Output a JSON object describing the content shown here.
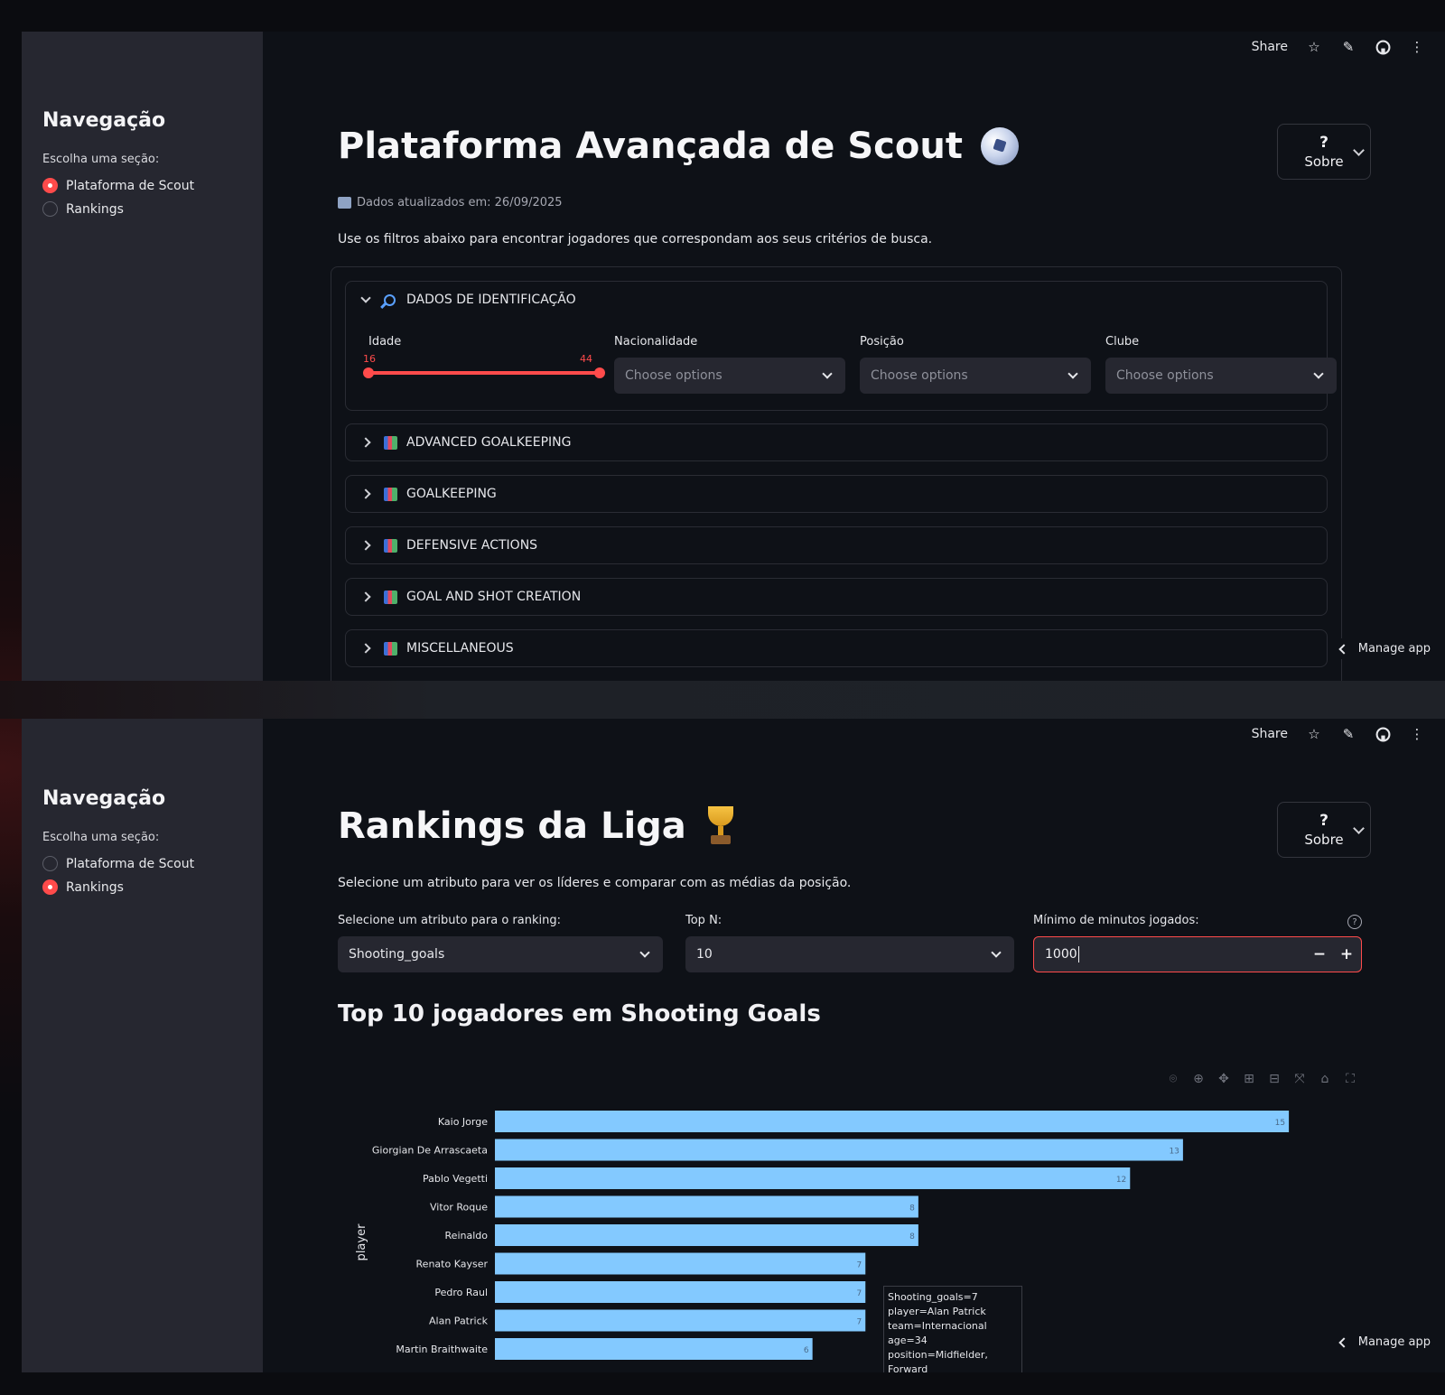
{
  "toolbar": {
    "share_label": "Share",
    "icons": [
      "star-icon",
      "pencil-icon",
      "github-icon",
      "more-vert-icon"
    ]
  },
  "sidebar": {
    "title": "Navegação",
    "label": "Escolha uma seção:",
    "options": [
      "Plataforma de Scout",
      "Rankings"
    ]
  },
  "sobre": {
    "q": "?",
    "label": "Sobre"
  },
  "manage_app": "Manage app",
  "page1": {
    "selected_option": "Plataforma de Scout",
    "title": "Plataforma Avançada de Scout",
    "updated": "Dados atualizados em: 26/09/2025",
    "description": "Use os filtros abaixo para encontrar jogadores que correspondam aos seus critérios de busca.",
    "identification": {
      "header": "DADOS DE IDENTIFICAÇÃO",
      "age_label": "Idade",
      "age_min": "16",
      "age_max": "44",
      "age_range": [
        16,
        44
      ],
      "age_scale": [
        16,
        44
      ],
      "nationality_label": "Nacionalidade",
      "position_label": "Posição",
      "club_label": "Clube",
      "placeholder": "Choose options"
    },
    "sections": [
      "ADVANCED GOALKEEPING",
      "GOALKEEPING",
      "DEFENSIVE ACTIONS",
      "GOAL AND SHOT CREATION",
      "MISCELLANEOUS"
    ]
  },
  "page2": {
    "selected_option": "Rankings",
    "title": "Rankings da Liga",
    "description": "Selecione um atributo para ver os líderes e comparar com as médias da posição.",
    "attribute_label": "Selecione um atributo para o ranking:",
    "attribute_value": "Shooting_goals",
    "topn_label": "Top N:",
    "topn_value": "10",
    "minutes_label": "Mínimo de minutos jogados:",
    "minutes_value": "1000",
    "minus": "−",
    "plus": "+",
    "help": "?",
    "chart_title": "Top 10 jogadores em Shooting Goals",
    "hover_lines": [
      "Shooting_goals=7",
      "player=Alan Patrick",
      "team=Internacional",
      "age=34",
      "position=Midfielder, Forward"
    ]
  },
  "chart_data": {
    "type": "bar",
    "orientation": "horizontal",
    "ylabel": "player",
    "categories": [
      "Kaio Jorge",
      "Giorgian De Arrascaeta",
      "Pablo Vegetti",
      "Vitor Roque",
      "Reinaldo",
      "Renato Kayser",
      "Pedro Raul",
      "Alan Patrick",
      "Martin Braithwaite"
    ],
    "values": [
      15,
      13,
      12,
      8,
      8,
      7,
      7,
      7,
      6
    ],
    "color": "#83c9ff",
    "xlim": [
      0,
      15.8
    ],
    "grid": false,
    "legend": "none"
  },
  "colors": {
    "accent": "#ff4b4b",
    "bar": "#83c9ff",
    "sidebar": "#262730",
    "bg": "#0e1117"
  }
}
